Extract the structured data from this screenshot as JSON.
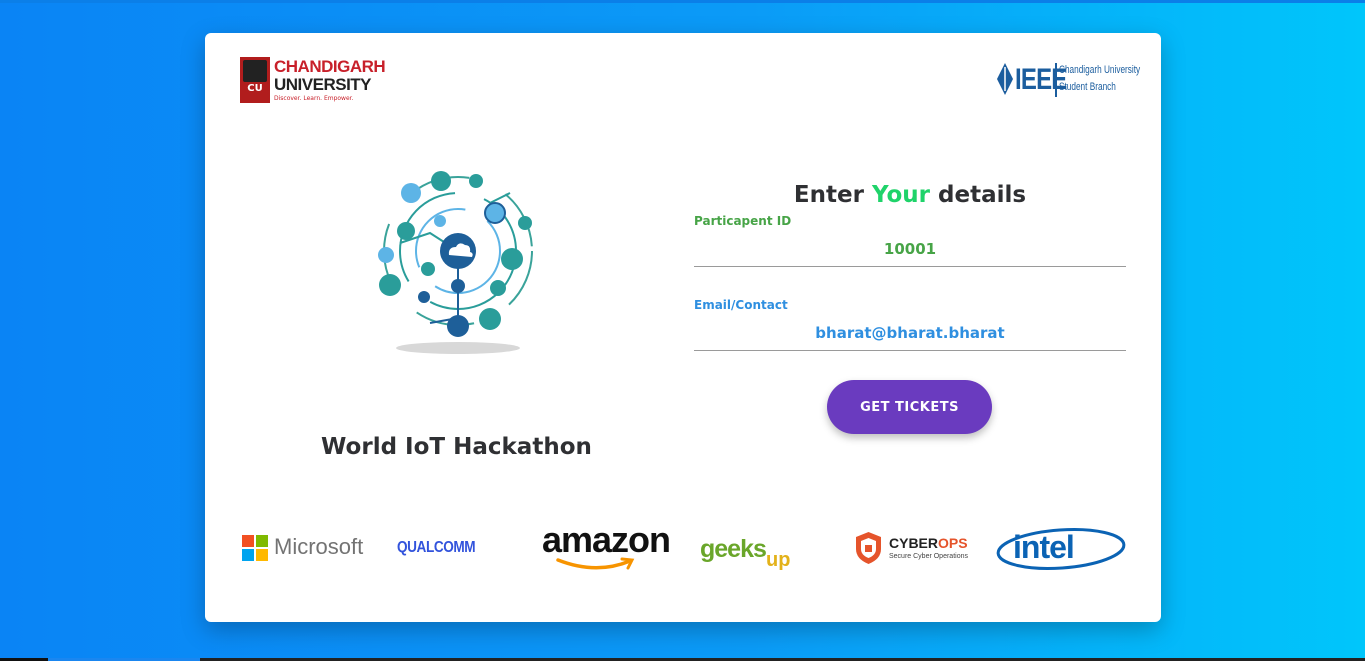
{
  "header": {
    "university_name_line1": "CHANDIGARH",
    "university_name_line2": "UNIVERSITY",
    "university_tagline": "Discover. Learn. Empower.",
    "emblem_text": "CU",
    "ieee_logo_text": "IEEE",
    "ieee_sub_line1": "Chandigarh University",
    "ieee_sub_line2": "Student Branch"
  },
  "hero": {
    "title": "World IoT Hackathon",
    "illustration_icon": "iot-cloud-network"
  },
  "form": {
    "title_before": "Enter ",
    "title_accent": "Your",
    "title_after": " details",
    "participant_label": "Particapent ID",
    "participant_value": "10001",
    "email_label": "Email/Contact",
    "email_value": "bharat@bharat.bharat",
    "submit_label": "GET TICKETS"
  },
  "sponsors": {
    "microsoft": "Microsoft",
    "qualcomm": "QUALCOMM",
    "amazon": "amazon",
    "geeks_part1": "geeks",
    "geeks_part2": "up",
    "cyberops_main": "CYBER",
    "cyberops_accent": "OPS",
    "cyberops_tagline": "Secure Cyber Operations",
    "intel": "intel"
  },
  "colors": {
    "background_start": "#0a84f5",
    "background_end": "#00c6fb",
    "accent_green": "#1fd36a",
    "label_green": "#47a447",
    "label_blue": "#2f8fe0",
    "button_purple": "#6a3bbf"
  }
}
